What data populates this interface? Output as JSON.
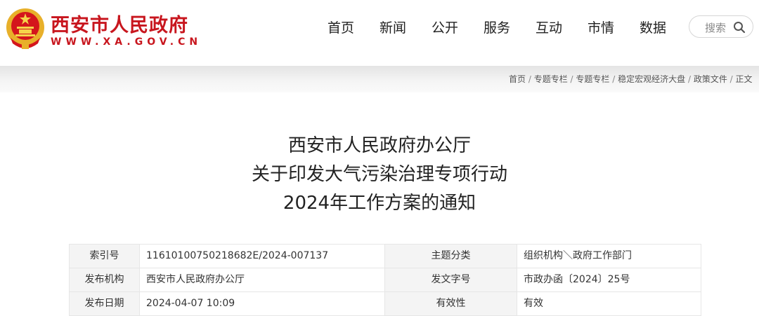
{
  "header": {
    "site_name": "西安市人民政府",
    "site_url": "WWW.XA.GOV.CN",
    "nav": [
      "首页",
      "新闻",
      "公开",
      "服务",
      "互动",
      "市情",
      "数据"
    ],
    "search_label": "搜索",
    "colors": {
      "brand": "#c8161e",
      "emblem_gold": "#e8b02a"
    }
  },
  "breadcrumb": [
    "首页",
    "专题专栏",
    "专题专栏",
    "稳定宏观经济大盘",
    "政策文件",
    "正文"
  ],
  "article": {
    "title_lines": [
      "西安市人民政府办公厅",
      "关于印发大气污染治理专项行动",
      "2024年工作方案的通知"
    ]
  },
  "meta": {
    "rows": [
      {
        "label1": "索引号",
        "value1": "11610100750218682E/2024-007137",
        "label2": "主题分类",
        "value2": "组织机构＼政府工作部门"
      },
      {
        "label1": "发布机构",
        "value1": "西安市人民政府办公厅",
        "label2": "发文字号",
        "value2": "市政办函〔2024〕25号"
      },
      {
        "label1": "发布日期",
        "value1": "2024-04-07 10:09",
        "label2": "有效性",
        "value2": "有效"
      }
    ]
  }
}
